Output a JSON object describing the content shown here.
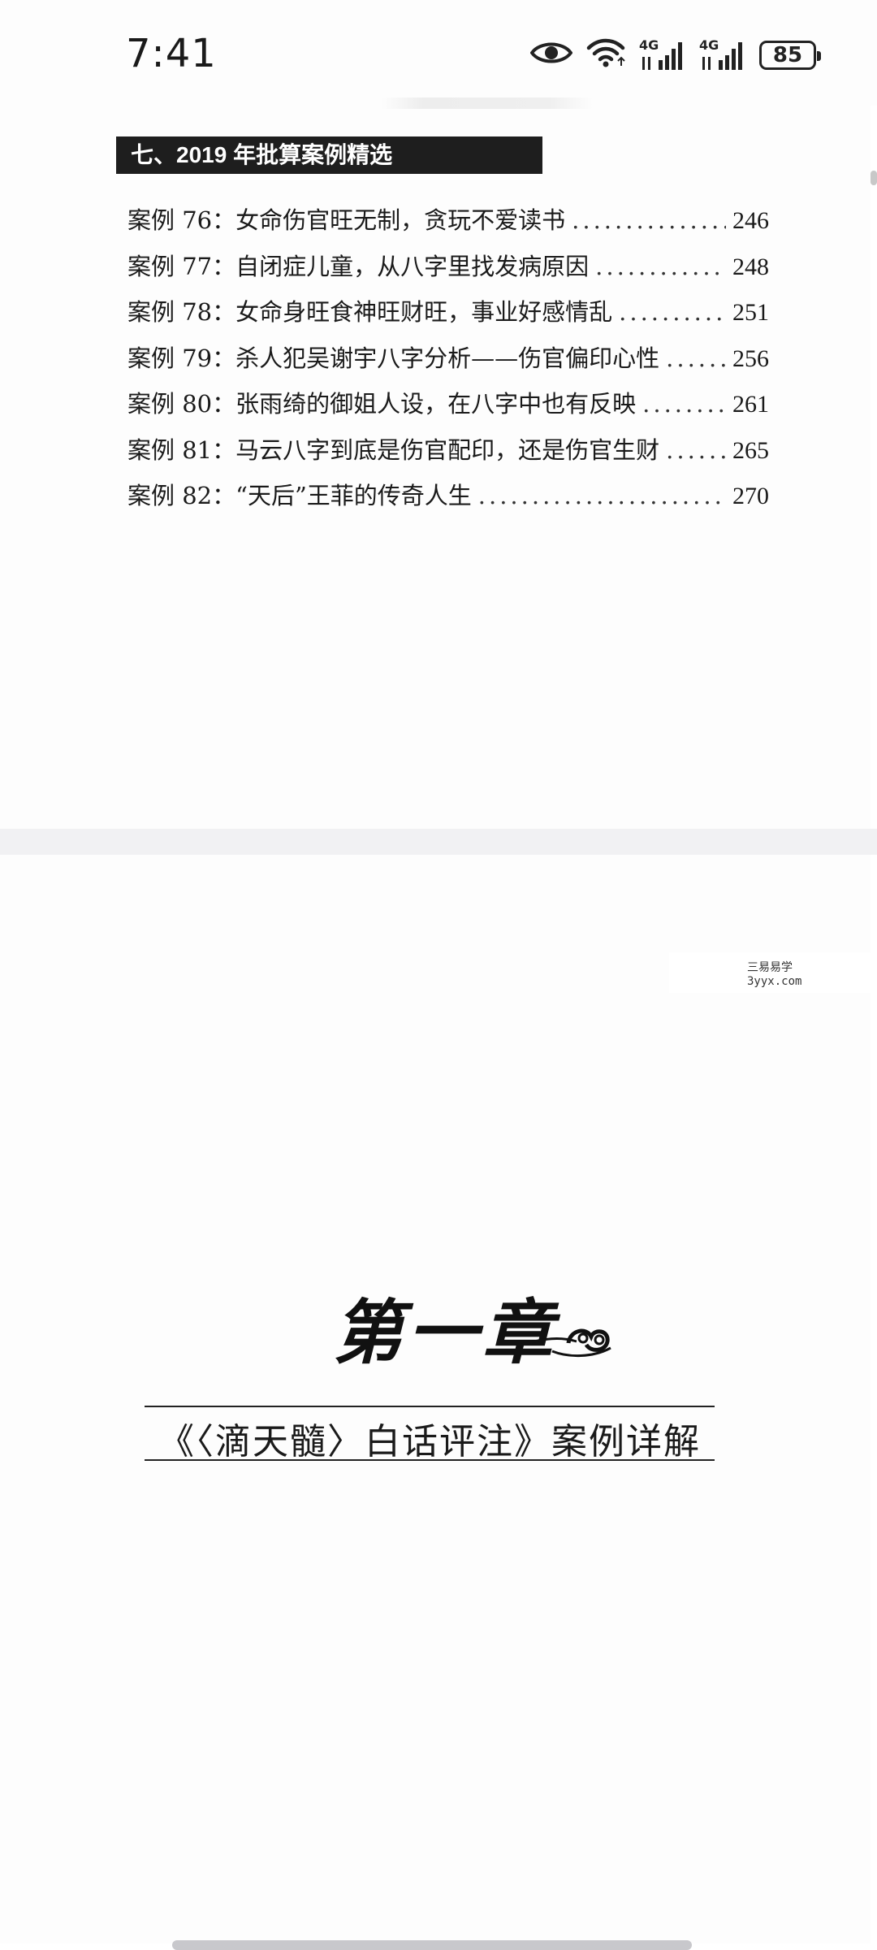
{
  "status_bar": {
    "time": "7:41",
    "network_1": "4G",
    "network_2": "4G",
    "battery": "85"
  },
  "section": {
    "header": "七、2019 年批算案例精选"
  },
  "toc": [
    {
      "case": "案例 76：",
      "title": "女命伤官旺无制，贪玩不爱读书",
      "page": "246"
    },
    {
      "case": "案例 77：",
      "title": "自闭症儿童，从八字里找发病原因",
      "page": "248"
    },
    {
      "case": "案例 78：",
      "title": "女命身旺食神旺财旺，事业好感情乱",
      "page": "251"
    },
    {
      "case": "案例 79：",
      "title": "杀人犯吴谢宇八字分析——伤官偏印心性",
      "page": "256"
    },
    {
      "case": "案例 80：",
      "title": "张雨绮的御姐人设，在八字中也有反映",
      "page": "261"
    },
    {
      "case": "案例 81：",
      "title": "马云八字到底是伤官配印，还是伤官生财",
      "page": "265"
    },
    {
      "case": "案例 82：",
      "title": "“天后”王菲的传奇人生",
      "page": "270"
    }
  ],
  "watermark": {
    "line1": "三易易学",
    "line2": "3yyx.com"
  },
  "chapter": {
    "title": "第一章",
    "subtitle": "《〈滴天髓〉白话评注》案例详解"
  },
  "icons": {
    "eye": "eye-icon",
    "wifi": "wifi-icon",
    "signal": "signal-icon",
    "battery": "battery-icon",
    "ornament": "cloud-ornament-icon"
  }
}
